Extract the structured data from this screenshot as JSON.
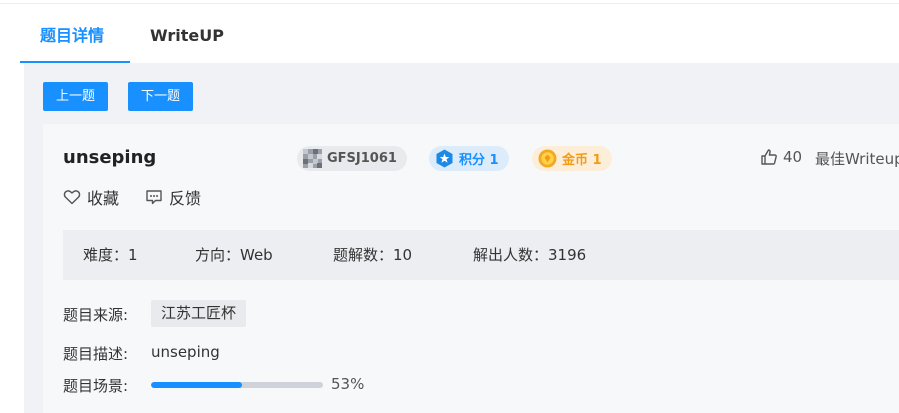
{
  "tabs": [
    {
      "label": "题目详情",
      "active": true
    },
    {
      "label": "WriteUP",
      "active": false
    }
  ],
  "nav": {
    "prev_label": "上一题",
    "next_label": "下一题"
  },
  "challenge": {
    "title": "unseping",
    "id_badge": "GFSJ1061",
    "score_badge": "积分 1",
    "coin_badge": "金币 1",
    "likes": "40",
    "best_writeup": "最佳Writeup",
    "favorite_label": "收藏",
    "feedback_label": "反馈"
  },
  "stats": {
    "difficulty": "难度：1",
    "direction": "方向：Web",
    "solves": "题解数：10",
    "solvers": "解出人数：3196"
  },
  "info": {
    "source_label": "题目来源:",
    "source_value": "江苏工匠杯",
    "desc_label": "题目描述:",
    "desc_value": "unseping",
    "scene_label": "题目场景:",
    "scene_progress": 0.53,
    "scene_progress_text": "53%"
  },
  "colors": {
    "accent": "#1890ff",
    "coin": "#f39c12",
    "page_bg": "#f0f2f5"
  },
  "icons": {
    "id_badge": "mosaic-avatar-icon",
    "score": "blue-star-gem-icon",
    "coin": "gold-coin-icon",
    "likes": "thumbs-up-icon",
    "favorite": "heart-outline-icon",
    "feedback": "chat-bubble-icon"
  }
}
